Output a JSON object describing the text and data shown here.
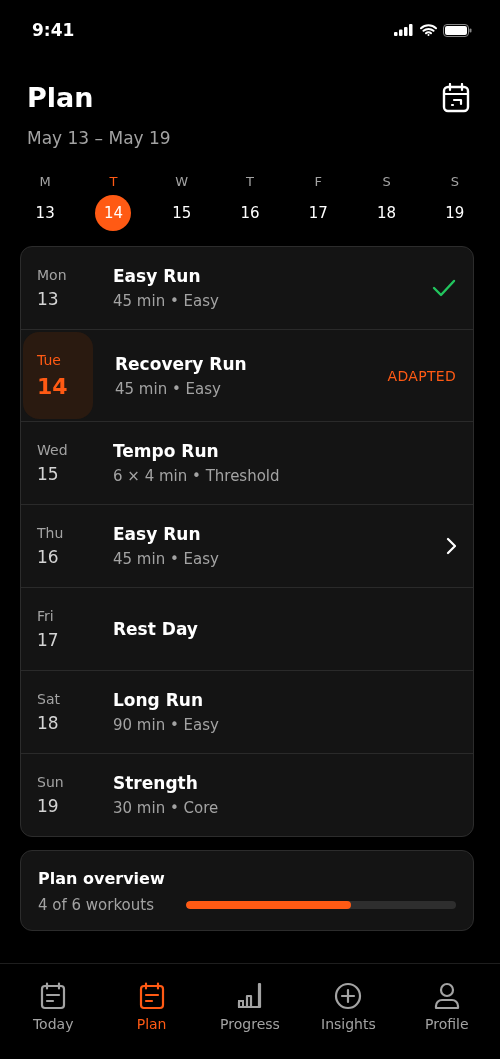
{
  "status_bar": {
    "time": "9:41"
  },
  "header": {
    "title": "Plan",
    "date_range": "May 13 – May 19"
  },
  "week": [
    {
      "letter": "M",
      "date": "13",
      "selected": false
    },
    {
      "letter": "T",
      "date": "14",
      "selected": true
    },
    {
      "letter": "W",
      "date": "15",
      "selected": false
    },
    {
      "letter": "T",
      "date": "16",
      "selected": false
    },
    {
      "letter": "F",
      "date": "17",
      "selected": false
    },
    {
      "letter": "S",
      "date": "18",
      "selected": false
    },
    {
      "letter": "S",
      "date": "19",
      "selected": false
    }
  ],
  "workouts": [
    {
      "day": "Mon",
      "date": "13",
      "title": "Easy Run",
      "detail": "45 min • Easy",
      "selected": false,
      "kind": "done"
    },
    {
      "day": "Tue",
      "date": "14",
      "title": "Recovery Run",
      "detail": "45 min • Easy",
      "selected": true,
      "kind": "badge",
      "badge": "ADAPTED"
    },
    {
      "day": "Wed",
      "date": "15",
      "title": "Tempo Run",
      "detail": "6 × 4 min • Threshold",
      "selected": false,
      "kind": "plain"
    },
    {
      "day": "Thu",
      "date": "16",
      "title": "Easy Run",
      "detail": "45 min • Easy",
      "selected": false,
      "kind": "next"
    },
    {
      "day": "Fri",
      "date": "17",
      "title": "Rest Day",
      "selected": false,
      "kind": "plain"
    },
    {
      "day": "Sat",
      "date": "18",
      "title": "Long Run",
      "detail": "90 min • Easy",
      "selected": false,
      "kind": "plain"
    },
    {
      "day": "Sun",
      "date": "19",
      "title": "Strength",
      "detail": "30 min • Core",
      "selected": false,
      "kind": "plain"
    }
  ],
  "overview": {
    "title": "Plan overview",
    "summary": "4 of 6 workouts",
    "level": 0.61
  },
  "tab_bar": [
    {
      "label": "Today",
      "kind": "calendar",
      "selected": false
    },
    {
      "label": "Plan",
      "kind": "calendar",
      "selected": true
    },
    {
      "label": "Progress",
      "kind": "chart",
      "selected": false
    },
    {
      "label": "Insights",
      "kind": "add",
      "selected": false
    },
    {
      "label": "Profile",
      "kind": "person",
      "selected": false
    }
  ]
}
